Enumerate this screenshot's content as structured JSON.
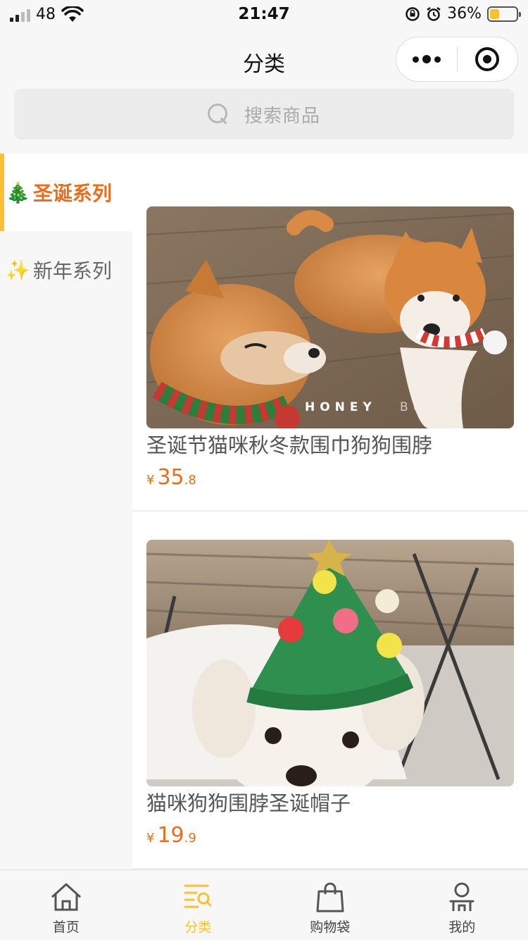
{
  "status_bar": {
    "signal_text": "48",
    "time": "21:47",
    "battery_percent": "36%",
    "battery_level": 0.36
  },
  "nav": {
    "title": "分类"
  },
  "search": {
    "placeholder": "搜索商品"
  },
  "sidebar": {
    "items": [
      {
        "emoji": "🎄",
        "label": "圣诞系列",
        "active": true
      },
      {
        "emoji": "✨",
        "label": "新年系列",
        "active": false
      }
    ]
  },
  "products": [
    {
      "name": "圣诞节猫咪秋冬款围巾狗狗围脖",
      "price_symbol": "¥",
      "price_int": "35",
      "price_dec": ".8",
      "watermark_left": "HONEY",
      "watermark_right": "BUNNY"
    },
    {
      "name": "猫咪狗狗围脖圣诞帽子",
      "price_symbol": "¥",
      "price_int": "19",
      "price_dec": ".9"
    }
  ],
  "tabbar": {
    "items": [
      {
        "label": "首页",
        "icon": "home-icon",
        "active": false
      },
      {
        "label": "分类",
        "icon": "category-icon",
        "active": true
      },
      {
        "label": "购物袋",
        "icon": "shopping-bag-icon",
        "active": false
      },
      {
        "label": "我的",
        "icon": "profile-icon",
        "active": false
      }
    ]
  },
  "colors": {
    "accent": "#f6c232",
    "price": "#e56f1f",
    "active_category": "#e56f1f"
  }
}
